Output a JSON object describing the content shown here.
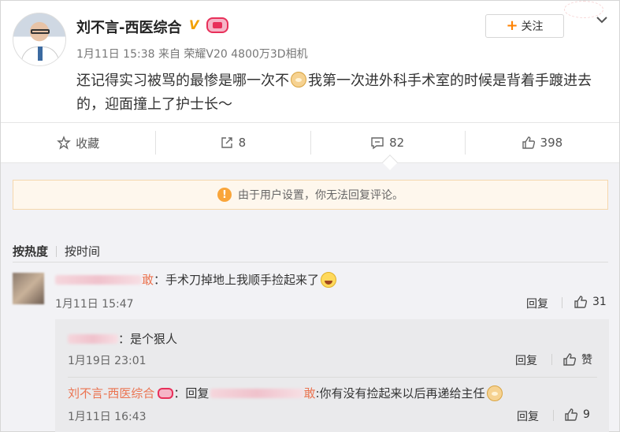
{
  "post": {
    "author": "刘不言-西医综合",
    "verified_badge": "V",
    "meta": "1月11日 15:38 来自 荣耀V20 4800万3D相机",
    "follow_label": "关注",
    "text_part1": "还记得实习被骂的最惨是哪一次不",
    "text_part2": "我第一次进外科手术室的时候是背着手踱进去的，迎面撞上了护士长～"
  },
  "actions": {
    "favorite_label": "收藏",
    "repost_count": "8",
    "comment_count": "82",
    "like_count": "398"
  },
  "notice": {
    "text": "由于用户设置，你无法回复评论。"
  },
  "sort": {
    "hot": "按热度",
    "time": "按时间"
  },
  "comment": {
    "name_tail": "敢",
    "text": "：手术刀掉地上我顺手捡起来了",
    "time": "1月11日 15:47",
    "reply_label": "回复",
    "likes": "31"
  },
  "replies": [
    {
      "text": "：是个狠人",
      "time": "1月19日 23:01",
      "reply_label": "回复",
      "like_label": "赞"
    },
    {
      "author": "刘不言-西医综合",
      "prefix": "：回复",
      "reply_to_tail": "敢",
      "text": ":你有没有捡起来以后再递给主任",
      "time": "1月11日 16:43",
      "reply_label": "回复",
      "likes": "9"
    }
  ],
  "colors": {
    "accent_orange": "#ff8200",
    "link_orange": "#eb7350",
    "notice_bg": "#fef7ed",
    "warn": "#f9a53a"
  }
}
